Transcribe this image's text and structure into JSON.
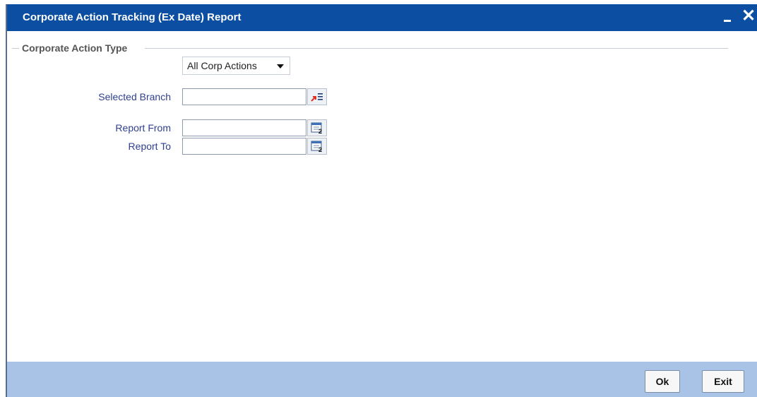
{
  "window": {
    "title": "Corporate Action Tracking (Ex Date) Report"
  },
  "section": {
    "label": "Corporate Action Type"
  },
  "corp_action_select": {
    "selected": "All Corp Actions"
  },
  "fields": {
    "selected_branch_label": "Selected Branch",
    "report_from_label": "Report From",
    "report_to_label": "Report To",
    "selected_branch_value": "",
    "report_from_value": "",
    "report_to_value": ""
  },
  "buttons": {
    "ok": "Ok",
    "exit": "Exit"
  },
  "colors": {
    "titlebar": "#0b4ea2",
    "footer": "#a8c3e6",
    "label": "#2e3f8f"
  },
  "icons": {
    "branch_lookup": "list-lookup-icon",
    "report_from_picker": "calendar-icon",
    "report_to_picker": "calendar-icon",
    "minimize": "minimize-icon",
    "close": "close-icon"
  }
}
